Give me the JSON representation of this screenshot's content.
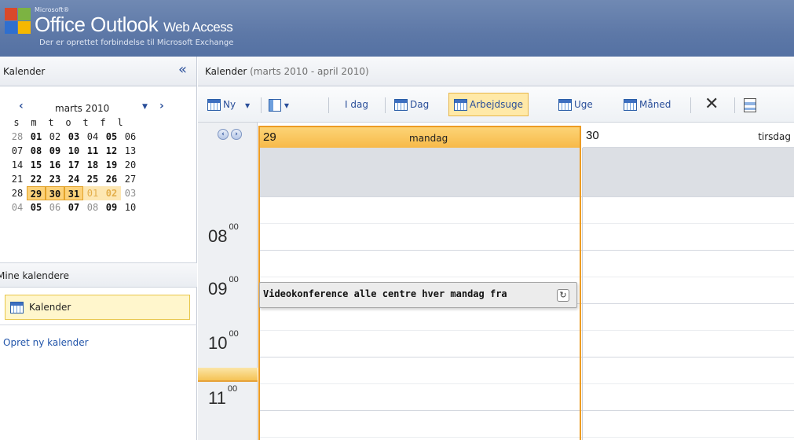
{
  "header": {
    "brand_small": "Microsoft®",
    "title": "Office Outlook",
    "title_suffix": "Web Access",
    "subtitle": "Der er oprettet forbindelse til Microsoft Exchange"
  },
  "left": {
    "title": "Kalender",
    "collapse": "«",
    "minical": {
      "month": "marts 2010",
      "prev": "‹",
      "next": "›",
      "weekdays": [
        "s",
        "m",
        "t",
        "o",
        "t",
        "f",
        "l"
      ],
      "rows": [
        [
          "28",
          "01",
          "02",
          "03",
          "04",
          "05",
          "06"
        ],
        [
          "07",
          "08",
          "09",
          "10",
          "11",
          "12",
          "13"
        ],
        [
          "14",
          "15",
          "16",
          "17",
          "18",
          "19",
          "20"
        ],
        [
          "21",
          "22",
          "23",
          "24",
          "25",
          "26",
          "27"
        ],
        [
          "28",
          "29",
          "30",
          "31",
          "01",
          "02",
          "03"
        ],
        [
          "04",
          "05",
          "06",
          "07",
          "08",
          "09",
          "10"
        ]
      ]
    },
    "my_calendars_label": "Mine kalendere",
    "calendar_item": "Kalender",
    "new_calendar": "Opret ny kalender"
  },
  "right": {
    "title": "Kalender",
    "range": "(marts 2010 - april 2010)",
    "toolbar": {
      "new": "Ny",
      "today": "I dag",
      "day": "Dag",
      "workweek": "Arbejdsuge",
      "week": "Uge",
      "month": "Måned"
    },
    "days": [
      {
        "num": "29",
        "name": "mandag"
      },
      {
        "num": "30",
        "name": "tirsdag"
      }
    ],
    "hours": [
      "08",
      "09",
      "10",
      "11"
    ],
    "hour_suffix": "00",
    "appointment": "Videokonference alle centre hver mandag fra"
  },
  "colors": {
    "header": "#5d78a7",
    "selected_day": "#f7b949",
    "accent_border": "#ec9c24",
    "link": "#2255aa"
  }
}
